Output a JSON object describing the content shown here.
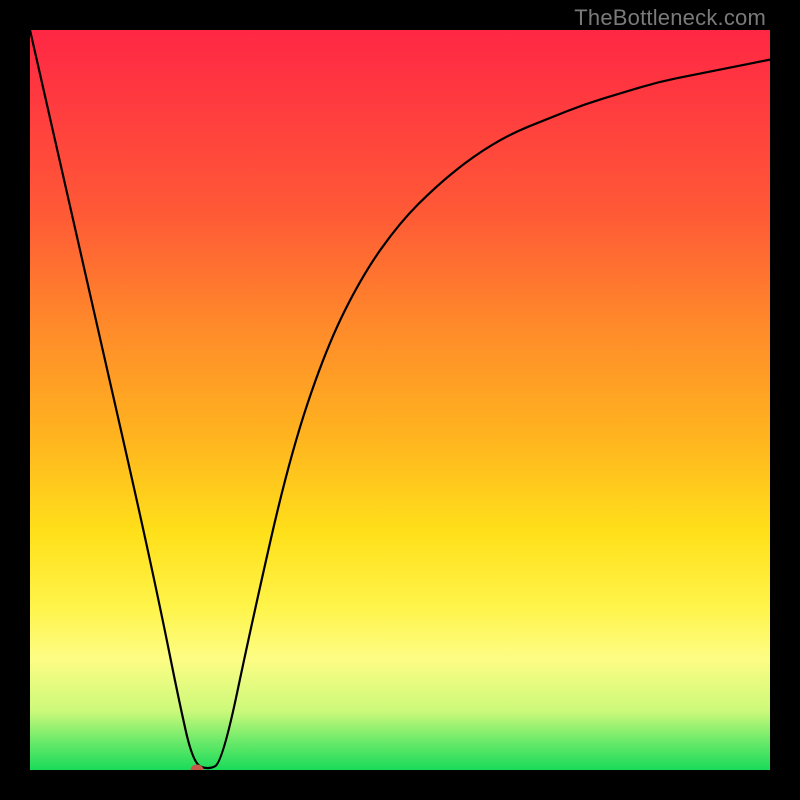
{
  "watermark": "TheBottleneck.com",
  "colors": {
    "background": "#000000",
    "curve": "#000000",
    "marker": "#c65a4a"
  },
  "chart_data": {
    "type": "line",
    "title": "",
    "xlabel": "",
    "ylabel": "",
    "xlim": [
      0,
      100
    ],
    "ylim": [
      0,
      100
    ],
    "grid": false,
    "legend": false,
    "annotations": [],
    "series": [
      {
        "name": "bottleneck-curve",
        "x": [
          0,
          5,
          10,
          15,
          18,
          20,
          22,
          24,
          26,
          30,
          35,
          40,
          45,
          50,
          55,
          60,
          65,
          70,
          75,
          80,
          85,
          90,
          95,
          100
        ],
        "y": [
          100,
          78,
          56,
          34,
          20,
          10,
          1,
          0,
          1,
          20,
          42,
          57,
          67,
          74,
          79,
          83,
          86,
          88,
          90,
          91.5,
          93,
          94,
          95,
          96
        ]
      }
    ],
    "marker": {
      "x": 22.5,
      "y": 0
    }
  }
}
